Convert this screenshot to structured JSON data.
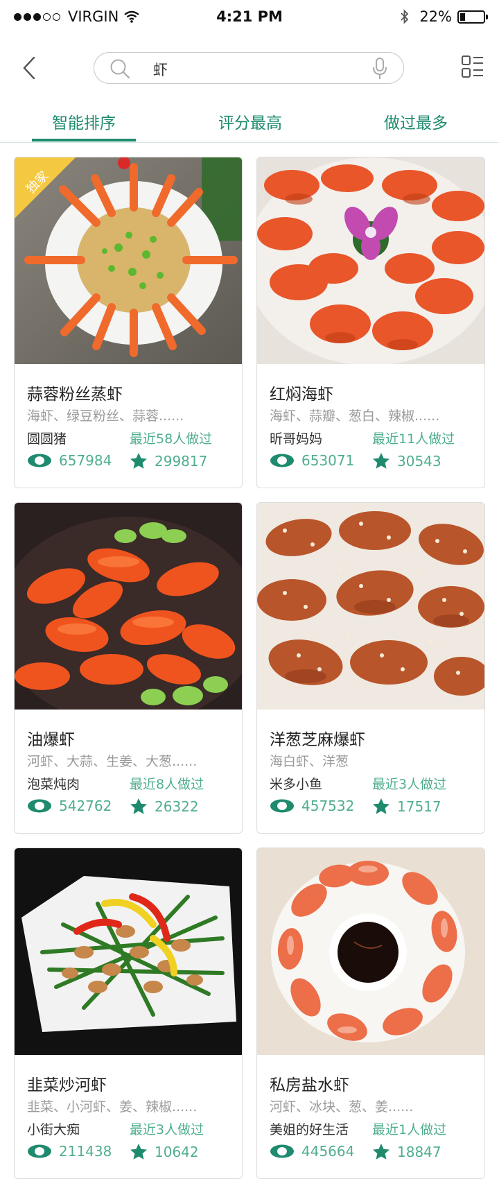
{
  "status_bar": {
    "carrier": "VIRGIN",
    "time": "4:21 PM",
    "battery": "22%",
    "battery_level": 0.22,
    "signal_bars_filled": 3,
    "signal_bars_total": 5
  },
  "search": {
    "query": "虾"
  },
  "tabs": [
    {
      "label": "智能排序",
      "active": true
    },
    {
      "label": "评分最高",
      "active": false
    },
    {
      "label": "做过最多",
      "active": false
    }
  ],
  "colors": {
    "accent": "#1e8a6e",
    "accent_light": "#4fae8f",
    "badge": "#f5c842"
  },
  "recipes": [
    {
      "title": "蒜蓉粉丝蒸虾",
      "ingredients": "海虾、绿豆粉丝、蒜蓉......",
      "author": "圆圆猪",
      "recent": "最近58人做过",
      "views": "657984",
      "favorites": "299817",
      "badge": "独家"
    },
    {
      "title": "红焖海虾",
      "ingredients": "海虾、蒜瓣、葱白、辣椒......",
      "author": "昕哥妈妈",
      "recent": "最近11人做过",
      "views": "653071",
      "favorites": "30543"
    },
    {
      "title": "油爆虾",
      "ingredients": "河虾、大蒜、生姜、大葱......",
      "author": "泡菜炖肉",
      "recent": "最近8人做过",
      "views": "542762",
      "favorites": "26322"
    },
    {
      "title": "洋葱芝麻爆虾",
      "ingredients": "海白虾、洋葱",
      "author": "米多小鱼",
      "recent": "最近3人做过",
      "views": "457532",
      "favorites": "17517"
    },
    {
      "title": "韭菜炒河虾",
      "ingredients": "韭菜、小河虾、姜、辣椒......",
      "author": "小街大痴",
      "recent": "最近3人做过",
      "views": "211438",
      "favorites": "10642"
    },
    {
      "title": "私房盐水虾",
      "ingredients": "河虾、冰块、葱、姜......",
      "author": "美姐的好生活",
      "recent": "最近1人做过",
      "views": "445664",
      "favorites": "18847"
    }
  ]
}
